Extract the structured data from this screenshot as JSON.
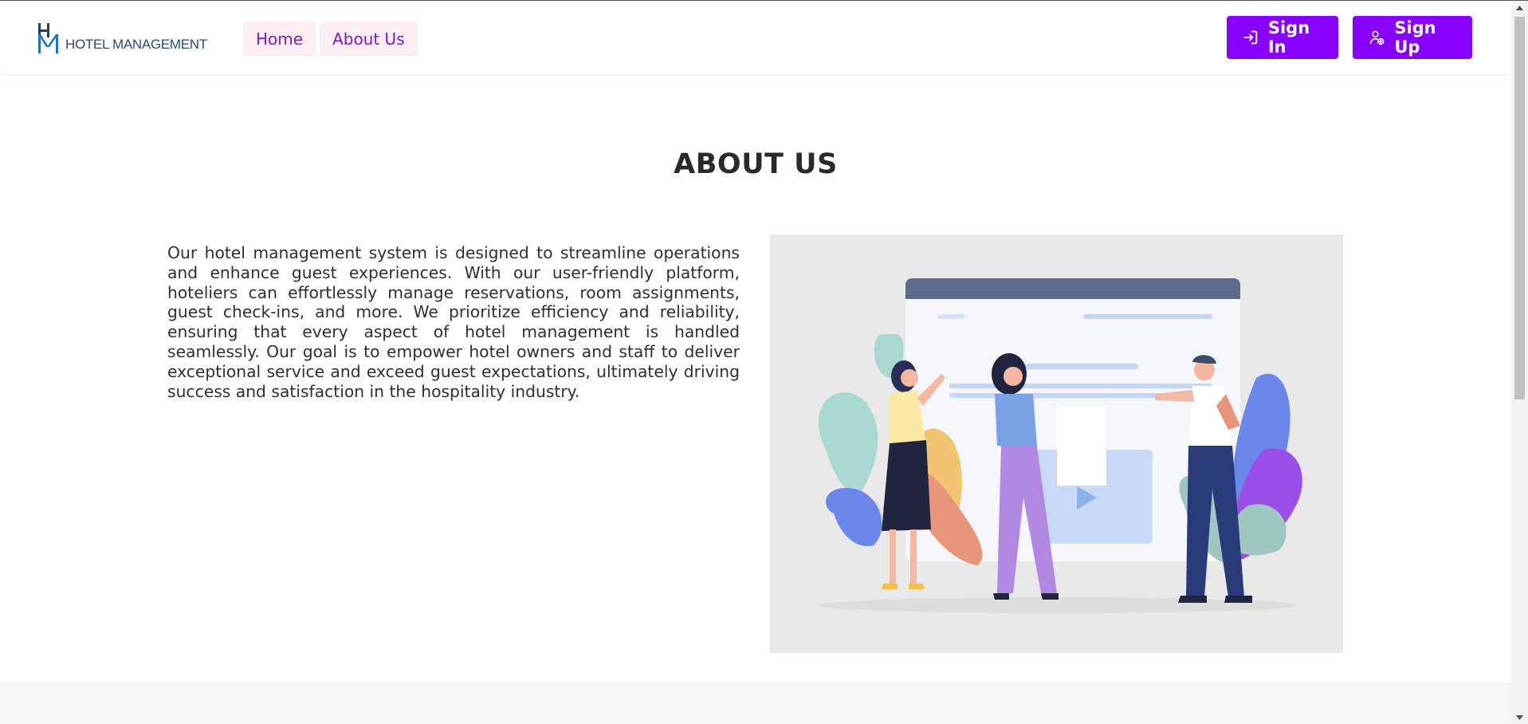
{
  "brand": {
    "logo_text": "HOTEL MANAGEMENT"
  },
  "nav": {
    "items": [
      {
        "label": "Home"
      },
      {
        "label": "About Us"
      }
    ]
  },
  "auth": {
    "sign_in_label": "Sign In",
    "sign_up_label": "Sign Up"
  },
  "main": {
    "title": "ABOUT US",
    "description": "Our hotel management system is designed to streamline operations and enhance guest experiences. With our user-friendly platform, hoteliers can effortlessly manage reservations, room assignments, guest check-ins, and more. We prioritize efficiency and reliability, ensuring that every aspect of hotel management is handled seamlessly. Our goal is to empower hotel owners and staff to deliver exceptional service and exceed guest expectations, ultimately driving success and satisfaction in the hospitality industry."
  },
  "colors": {
    "accent": "#8800ff",
    "nav_link_bg": "#fdeef5",
    "nav_link_text": "#7a18d6",
    "logo": "#2b4a7a"
  }
}
